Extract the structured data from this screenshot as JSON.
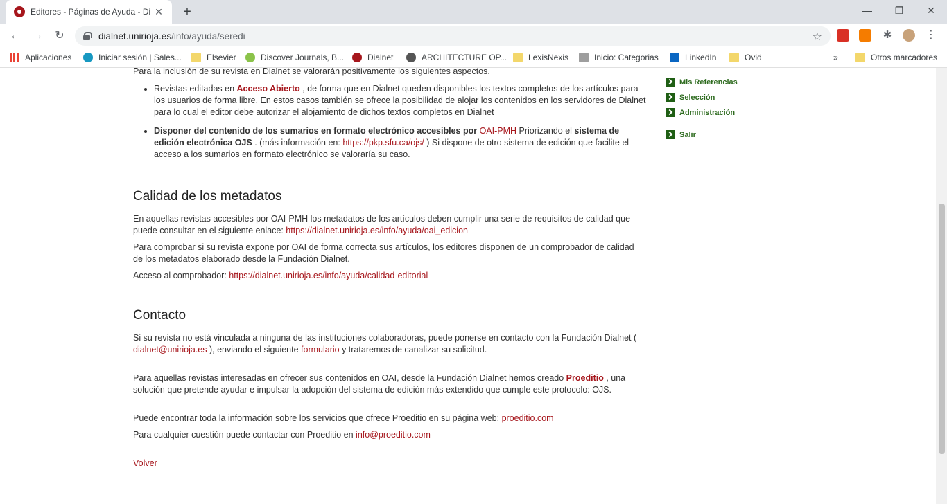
{
  "browser": {
    "tab_title": "Editores - Páginas de Ayuda - Di",
    "url_host": "dialnet.unirioja.es",
    "url_path": "/info/ayuda/seredi",
    "bookmarks": [
      "Aplicaciones",
      "Iniciar sesión | Sales...",
      "Elsevier",
      "Discover Journals, B...",
      "Dialnet",
      "ARCHITECTURE OP...",
      "LexisNexis",
      "Inicio: Categorias",
      "LinkedIn",
      "Ovid"
    ],
    "more_bookmarks": "»",
    "other_bookmarks": "Otros marcadores"
  },
  "intro": "Para la inclusión de su revista en Dialnet se valorarán positivamente los siguientes aspectos.",
  "bullet1": {
    "pre": "Revistas editadas en ",
    "link": "Acceso Abierto",
    "post": " , de forma que en Dialnet queden disponibles los textos completos de los artículos para los usuarios de forma libre. En estos casos también se ofrece la posibilidad de alojar los contenidos en los servidores de Dialnet para lo cual el editor debe autorizar el alojamiento de dichos textos completos en Dialnet"
  },
  "bullet2": {
    "bold1": "Disponer del contenido de los sumarios en formato electrónico accesibles por ",
    "link1": "OAI-PMH",
    "mid": " Priorizando el ",
    "bold2": "sistema de edición electrónica OJS",
    "mid2": " . (más información en: ",
    "link2": "https://pkp.sfu.ca/ojs/",
    "post": " ) Si dispone de otro sistema de edición que facilite el acceso a los sumarios en formato electrónico se valoraría su caso."
  },
  "section_metadata": {
    "heading": "Calidad de los metadatos",
    "p1": "En aquellas revistas accesibles por OAI-PMH los metadatos de los artículos deben cumplir una serie de requisitos de calidad que puede consultar en el siguiente enlace: ",
    "p1_link": "https://dialnet.unirioja.es/info/ayuda/oai_edicion",
    "p2": "Para comprobar si su revista expone por OAI de forma correcta sus artículos, los editores disponen de un comprobador de calidad de los metadatos elaborado desde la Fundación Dialnet.",
    "p3": "Acceso al comprobador: ",
    "p3_link": "https://dialnet.unirioja.es/info/ayuda/calidad-editorial"
  },
  "section_contact": {
    "heading": "Contacto",
    "p1_pre": "Si su revista no está vinculada a ninguna de las instituciones colaboradoras, puede ponerse en contacto con la Fundación Dialnet ( ",
    "p1_email": "dialnet@unirioja.es",
    "p1_mid": " ), enviando el siguiente ",
    "p1_form": "formulario",
    "p1_post": " y trataremos de canalizar su solicitud.",
    "p2_pre": "Para aquellas revistas interesadas en ofrecer sus contenidos en OAI, desde la Fundación Dialnet hemos creado ",
    "p2_link": "Proeditio",
    "p2_post": " , una solución que pretende ayudar e impulsar la adopción del sistema de edición más extendido que cumple este protocolo: OJS.",
    "p3_pre": "Puede encontrar toda la información sobre los servicios que ofrece Proeditio en su página web: ",
    "p3_link": "proeditio.com",
    "p4_pre": "Para cualquier cuestión puede contactar con Proeditio en ",
    "p4_link": "info@proeditio.com",
    "back": "Volver"
  },
  "sidebar": [
    "Mis Referencias",
    "Selección",
    "Administración",
    "Salir"
  ],
  "colors": {
    "link": "#a6161c",
    "sidebar_green": "#2e6b1f"
  }
}
